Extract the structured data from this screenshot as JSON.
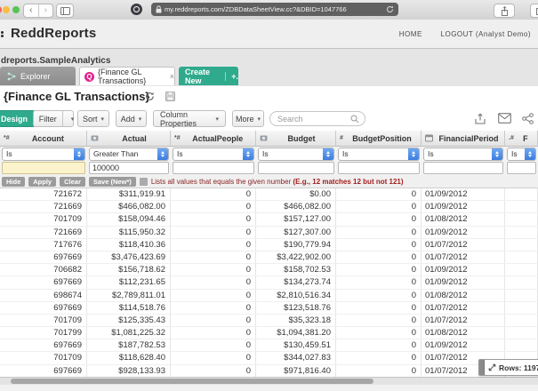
{
  "browser": {
    "url": "my.reddreports.com/ZDBDataSheetView.cc?&DBID=1047766",
    "back": "‹",
    "forward": "›"
  },
  "app_header": {
    "brand": "ReddReports",
    "home": "HOME",
    "logout": "LOGOUT (Analyst Demo)"
  },
  "breadcrumb": "dreports.SampleAnalytics",
  "tabs": {
    "explorer": "Explorer",
    "active": "{Finance GL Transactions}",
    "active_icon": "Q",
    "close": "×",
    "create_new": "Create New",
    "plus": "+."
  },
  "page": {
    "title": "{Finance GL Transactions}"
  },
  "toolbar": {
    "design": "Design",
    "filter": "Filter",
    "sort": "Sort",
    "add": "Add",
    "column_properties": "Column Properties",
    "more": "More",
    "caret": "▾",
    "search_placeholder": "Search"
  },
  "filter_bar": {
    "operators": [
      "Is",
      "Greater Than",
      "Is",
      "Is",
      "Is",
      "Is",
      "Is"
    ],
    "values": [
      "",
      "100000",
      "",
      "",
      "",
      "",
      ""
    ],
    "buttons": [
      "Hide",
      "Apply",
      "Clear",
      "Save (New*)"
    ],
    "help_plain": "Lists all values that equals the given number ",
    "help_bold": "(E.g., 12 matches 12 but not 121)"
  },
  "table": {
    "columns": [
      {
        "icon": "*#",
        "label": "Account"
      },
      {
        "icon": "currency",
        "label": "Actual"
      },
      {
        "icon": "*#",
        "label": "ActualPeople"
      },
      {
        "icon": "currency",
        "label": "Budget"
      },
      {
        "icon": "#",
        "label": "BudgetPosition"
      },
      {
        "icon": "calendar",
        "label": "FinancialPeriod"
      },
      {
        "icon": ".#",
        "label": "F"
      }
    ],
    "rows": [
      [
        "721672",
        "$311,919.91",
        "0",
        "$0.00",
        "0",
        "01/09/2012",
        ""
      ],
      [
        "721669",
        "$466,082.00",
        "0",
        "$466,082.00",
        "0",
        "01/09/2012",
        ""
      ],
      [
        "701709",
        "$158,094.46",
        "0",
        "$157,127.00",
        "0",
        "01/08/2012",
        ""
      ],
      [
        "721669",
        "$115,950.32",
        "0",
        "$127,307.00",
        "0",
        "01/09/2012",
        ""
      ],
      [
        "717676",
        "$118,410.36",
        "0",
        "$190,779.94",
        "0",
        "01/07/2012",
        ""
      ],
      [
        "697669",
        "$3,476,423.69",
        "0",
        "$3,422,902.00",
        "0",
        "01/07/2012",
        ""
      ],
      [
        "706682",
        "$156,718.62",
        "0",
        "$158,702.53",
        "0",
        "01/09/2012",
        ""
      ],
      [
        "697669",
        "$112,231.65",
        "0",
        "$134,273.74",
        "0",
        "01/09/2012",
        ""
      ],
      [
        "698674",
        "$2,789,811.01",
        "0",
        "$2,810,516.34",
        "0",
        "01/08/2012",
        ""
      ],
      [
        "697669",
        "$114,518.76",
        "0",
        "$123,518.76",
        "0",
        "01/07/2012",
        ""
      ],
      [
        "701709",
        "$125,335.43",
        "0",
        "$35,323.18",
        "0",
        "01/07/2012",
        ""
      ],
      [
        "701799",
        "$1,081,225.32",
        "0",
        "$1,094,381.20",
        "0",
        "01/08/2012",
        ""
      ],
      [
        "697669",
        "$187,782.53",
        "0",
        "$130,459.51",
        "0",
        "01/09/2012",
        ""
      ],
      [
        "701709",
        "$118,628.40",
        "0",
        "$344,027.83",
        "0",
        "01/07/2012",
        ""
      ],
      [
        "697669",
        "$928,133.93",
        "0",
        "$971,816.40",
        "0",
        "01/07/2012",
        ""
      ]
    ]
  },
  "status": {
    "rows_label": "Rows: 1197"
  },
  "colors": {
    "accent_green": "#2faa8d",
    "tab_pink": "#e0218a",
    "select_blue": "#3c7de0",
    "help_maroon": "#8a2424",
    "highlight_yellow": "#fbf3cb"
  }
}
